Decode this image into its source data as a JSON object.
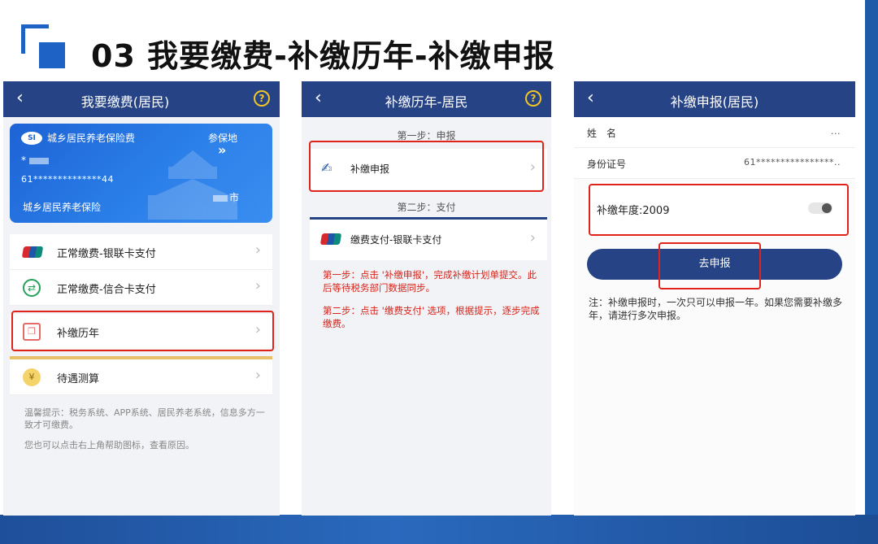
{
  "slide": {
    "title": "03 我要缴费-补缴历年-补缴申报"
  },
  "phone1": {
    "nav_title": "我要缴费(居民)",
    "help_icon_glyph": "?",
    "card": {
      "logo_text": "SI",
      "insurance_name": "城乡居民养老保险费",
      "region_label": "参保地",
      "person_initial": "*",
      "id_number": "61**************44",
      "city": "市",
      "type": "城乡居民养老保险"
    },
    "menu": [
      {
        "label": "正常缴费-银联卡支付",
        "icon": "unionpay-icon"
      },
      {
        "label": "正常缴费-信合卡支付",
        "icon": "xinhe-icon"
      },
      {
        "label": "补缴历年",
        "icon": "bujiao-icon"
      },
      {
        "label": "待遇测算",
        "icon": "calculator-icon"
      }
    ],
    "tip1": "温馨提示：税务系统、APP系统、居民养老系统，信息多方一致才可缴费。",
    "tip2": "您也可以点击右上角帮助图标，查看原因。"
  },
  "phone2": {
    "nav_title": "补缴历年-居民",
    "step1_label": "第一步：申报",
    "row1_label": "补缴申报",
    "step2_label": "第二步：支付",
    "row2_label": "缴费支付-银联卡支付",
    "note1": "第一步：点击 '补缴申报'，完成补缴计划单提交。此后等待税务部门数据同步。",
    "note2": "第二步：点击 '缴费支付' 选项，根据提示，逐步完成缴费。"
  },
  "phone3": {
    "nav_title": "补缴申报(居民)",
    "name_label": "姓　名",
    "name_value": "...",
    "id_label": "身份证号",
    "id_value": "61****************..",
    "year_label": "补缴年度:2009",
    "button_label": "去申报",
    "note": "注：补缴申报时，一次只可以申报一年。如果您需要补缴多年，请进行多次申报。"
  },
  "colors": {
    "navbar": "#264386",
    "accent_blue": "#1e62c6",
    "highlight_red": "#e0241b",
    "note_red": "#d9231a"
  }
}
